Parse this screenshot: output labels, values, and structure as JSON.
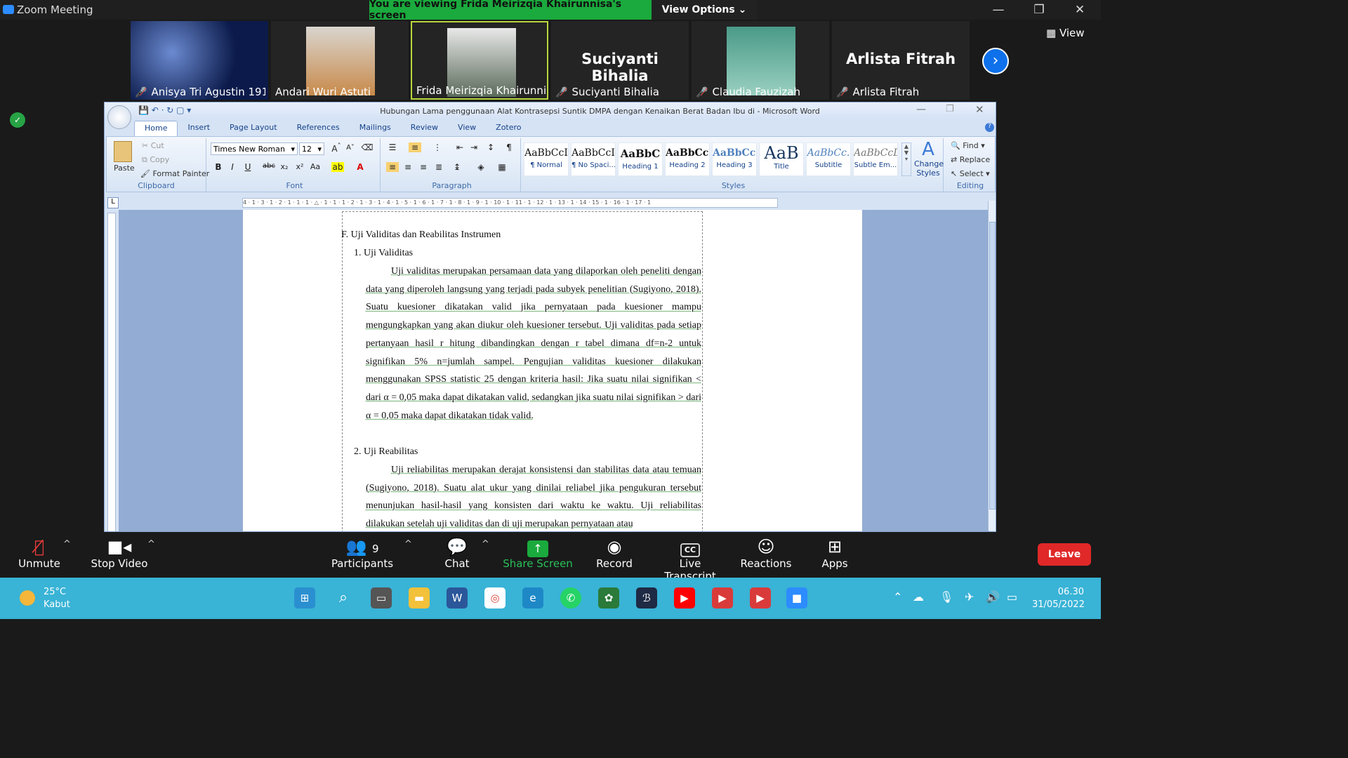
{
  "zoom": {
    "window_title": "Zoom Meeting",
    "viewing_banner": "You are viewing Frida Meirizqia Khairunnisa's screen",
    "view_options": "View Options",
    "view_button": "View",
    "participants": [
      {
        "name": "Anisya Tri Agustin 191...",
        "muted": true,
        "kind": "photo"
      },
      {
        "name": "Andari Wuri Astuti",
        "muted": false,
        "kind": "photo"
      },
      {
        "name": "Frida Meirizqia Khairunni...",
        "muted": false,
        "kind": "photo"
      },
      {
        "name": "Suciyanti Bihalia",
        "big": "Suciyanti Bihalia",
        "muted": true,
        "kind": "name"
      },
      {
        "name": "Claudia Fauzizah",
        "muted": true,
        "kind": "photo"
      },
      {
        "name": "Arlista Fitrah",
        "big": "Arlista Fitrah",
        "muted": true,
        "kind": "name"
      }
    ],
    "controls": {
      "unmute": "Unmute",
      "stop_video": "Stop Video",
      "participants": "Participants",
      "participants_count": "9",
      "chat": "Chat",
      "share_screen": "Share Screen",
      "record": "Record",
      "live_transcript": "Live Transcript",
      "reactions": "Reactions",
      "apps": "Apps",
      "leave": "Leave"
    }
  },
  "word": {
    "title": "Hubungan Lama penggunaan Alat Kontrasepsi Suntik DMPA dengan Kenaikan Berat Badan Ibu di - Microsoft Word",
    "tabs": [
      "Home",
      "Insert",
      "Page Layout",
      "References",
      "Mailings",
      "Review",
      "View",
      "Zotero"
    ],
    "clipboard": {
      "paste": "Paste",
      "cut": "Cut",
      "copy": "Copy",
      "format_painter": "Format Painter",
      "label": "Clipboard"
    },
    "font": {
      "name": "Times New Roman",
      "size": "12",
      "label": "Font"
    },
    "paragraph_label": "Paragraph",
    "styles": [
      {
        "preview": "AaBbCcI",
        "label": "¶ Normal"
      },
      {
        "preview": "AaBbCcI",
        "label": "¶ No Spaci..."
      },
      {
        "preview": "AaBbC",
        "label": "Heading 1"
      },
      {
        "preview": "AaBbCcI",
        "label": "Heading 2"
      },
      {
        "preview": "AaBbCcI",
        "label": "Heading 3"
      },
      {
        "preview": "AaB",
        "label": "Title"
      },
      {
        "preview": "AaBbCc.",
        "label": "Subtitle"
      },
      {
        "preview": "AaBbCcD",
        "label": "Subtle Em..."
      }
    ],
    "styles_label": "Styles",
    "change_styles": "Change Styles",
    "editing": {
      "find": "Find",
      "replace": "Replace",
      "select": "Select",
      "label": "Editing"
    },
    "ruler": "4 · 1 · 3 · 1 · 2 · 1 · 1 · 1 · △ · 1 · 1 · 1 · 2 · 1 · 3 · 1 · 4 · 1 · 5 · 1 · 6 · 1 · 7 · 1 · 8 · 1 · 9 · 1 · 10 · 1 · 11 · 1 · 12 · 1 · 13 · 1 · 14 · 15 · 1 · 16 · 1 · 17 · 1",
    "doc": {
      "heading": "F.  Uji Validitas dan Reabilitas Instrumen",
      "sub1": "1.  Uji Validitas",
      "para1": "Uji validitas merupakan persamaan data yang dilaporkan oleh peneliti dengan data yang diperoleh langsung yang terjadi pada subyek penelitian (Sugiyono, 2018). Suatu kuesioner dikatakan valid jika pernyataan pada kuesioner mampu mengungkapkan yang akan diukur oleh kuesioner tersebut. Uji validitas pada setiap pertanyaan hasil r hitung dibandingkan dengan r tabel dimana df=n-2 untuk signifikan 5% n=jumlah sampel. Pengujian validitas kuesioner dilakukan menggunakan SPSS statistic 25 dengan kriteria hasil: Jika suatu nilai signifikan < dari α = 0,05 maka dapat dikatakan valid, sedangkan jika suatu nilai signifikan > dari α = 0,05 maka dapat dikatakan tidak valid.",
      "sub2": "2.  Uji Reabilitas",
      "para2": "Uji reliabilitas merupakan derajat konsistensi dan stabilitas data atau temuan (Sugiyono, 2018). Suatu alat ukur yang dinilai reliabel jika pengukuran tersebut menunjukan hasil-hasil yang konsisten dari waktu ke waktu. Uji reliabilitas dilakukan setelah uji validitas dan di uji merupakan pernyataan atau"
    }
  },
  "taskbar": {
    "weather_temp": "25°C",
    "weather_desc": "Kabut",
    "time": "06.30",
    "date": "31/05/2022"
  },
  "colors": {
    "zoom_green": "#1aaa3d",
    "zoom_blue": "#0e71eb",
    "leave_red": "#e02828",
    "taskbar": "#39b3d6"
  }
}
